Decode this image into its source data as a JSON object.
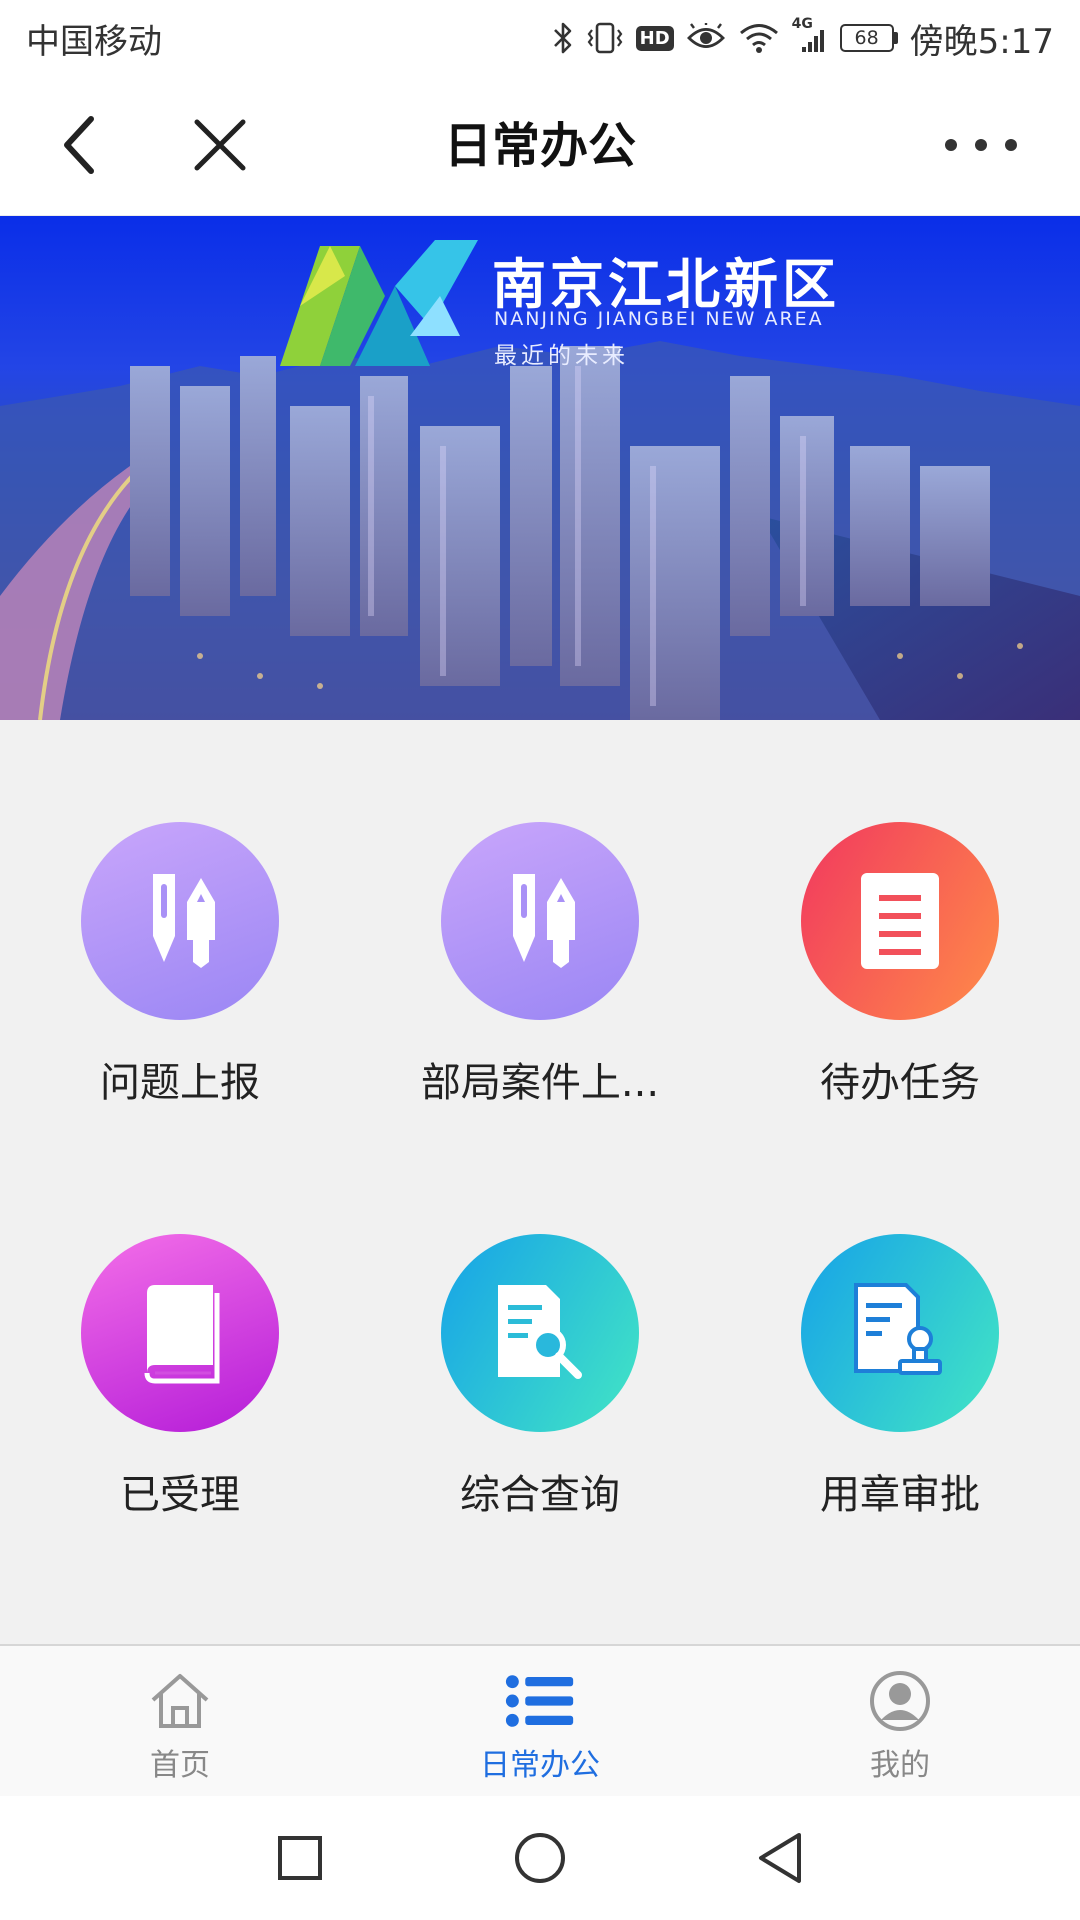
{
  "status_bar": {
    "carrier": "中国移动",
    "network_label": "4G",
    "battery_level": "68",
    "time": "傍晚5:17",
    "icons": [
      "bluetooth-icon",
      "vibrate-icon",
      "hd-icon",
      "eye-icon",
      "wifi-icon",
      "signal-icon",
      "battery-icon"
    ],
    "hd_label": "HD"
  },
  "nav": {
    "title": "日常办公",
    "back_icon": "chevron-left-icon",
    "close_icon": "close-icon",
    "more_icon": "more-icon"
  },
  "banner": {
    "title": "南京江北新区",
    "subtitle": "NANJING JIANGBEI NEW AREA",
    "slogan": "最近的未来"
  },
  "grid": [
    {
      "label": "问题上报",
      "icon": "pen-pencil-icon",
      "color_from": "#c7a2fb",
      "color_to": "#9b84f5"
    },
    {
      "label": "部局案件上...",
      "icon": "pen-pencil-icon",
      "color_from": "#c7a2fb",
      "color_to": "#9b84f5"
    },
    {
      "label": "待办任务",
      "icon": "document-icon",
      "color_from": "#f2445e",
      "color_to": "#ff8a4a"
    },
    {
      "label": "已受理",
      "icon": "book-icon",
      "color_from": "#f066e6",
      "color_to": "#b61fd8"
    },
    {
      "label": "综合查询",
      "icon": "search-document-icon",
      "color_from": "#1aa6e8",
      "color_to": "#3fe3c6"
    },
    {
      "label": "用章审批",
      "icon": "stamp-document-icon",
      "color_from": "#1aa6e8",
      "color_to": "#3fe3c6"
    }
  ],
  "tabs": [
    {
      "label": "首页",
      "icon": "home-icon",
      "active": false
    },
    {
      "label": "日常办公",
      "icon": "list-icon",
      "active": true
    },
    {
      "label": "我的",
      "icon": "user-icon",
      "active": false
    }
  ],
  "colors": {
    "accent": "#1f6ee0",
    "inactive_tab": "#888888",
    "background": "#f1f1f1"
  },
  "system_nav": [
    "recent-apps-icon",
    "home-circle-icon",
    "back-triangle-icon"
  ]
}
